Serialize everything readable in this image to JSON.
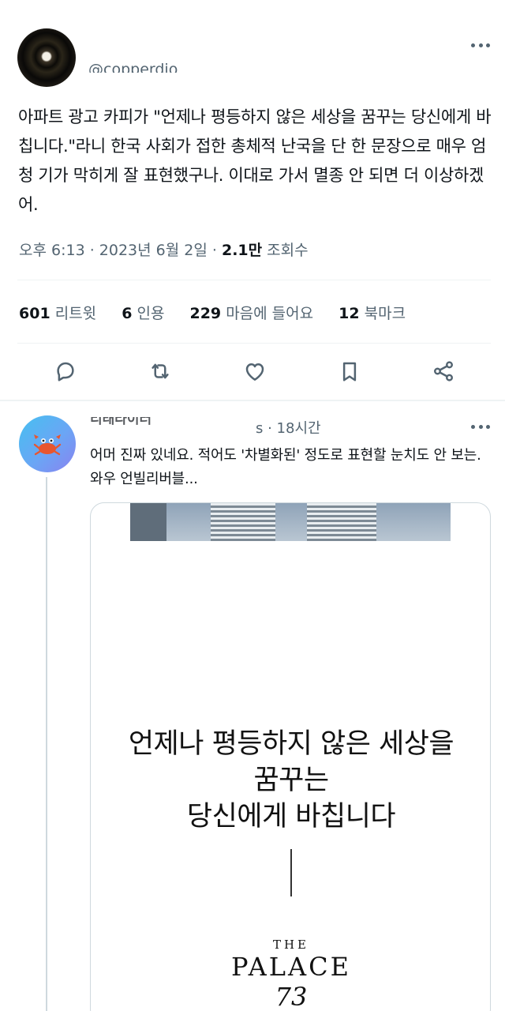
{
  "main_tweet": {
    "handle": "@copperdio",
    "text": "아파트 광고 카피가 \"언제나 평등하지 않은 세상을 꿈꾸는 당신에게 바칩니다.\"라니 한국 사회가 접한 총체적 난국을 단 한 문장으로 매우 엄청 기가 막히게 잘 표현했구나. 이대로 가서 멸종 안 되면 더 이상하겠어.",
    "time": "오후 6:13",
    "sep": " · ",
    "date": "2023년 6월 2일",
    "views_count": "2.1만",
    "views_label": " 조회수",
    "stats": {
      "retweets_count": "601",
      "retweets_label": " 리트윗",
      "quotes_count": "6",
      "quotes_label": " 인용",
      "likes_count": "229",
      "likes_label": " 마음에 들어요",
      "bookmarks_count": "12",
      "bookmarks_label": " 북마크"
    },
    "actions": [
      "reply-icon",
      "retweet-icon",
      "like-icon",
      "bookmark-icon",
      "share-icon"
    ]
  },
  "reply": {
    "name": "티태라이터",
    "time": "s · 18시간",
    "text": "어머 진짜 있네요. 적어도 '차별화된' 정도로 표현할 눈치도 안 보는. 와우 언빌리버블...",
    "card": {
      "headline_line1": "언제나 평등하지 않은 세상을",
      "headline_line2": "꿈꾸는",
      "headline_line3": "당신에게 바칩니다",
      "brand_the": "THE",
      "brand_name": "PALACE",
      "brand_number": "73"
    }
  },
  "colors": {
    "text_primary": "#0f1419",
    "text_secondary": "#536471",
    "divider": "#eff3f4",
    "thread_line": "#cfd9de",
    "reply_avatar": "#46c0f0"
  }
}
